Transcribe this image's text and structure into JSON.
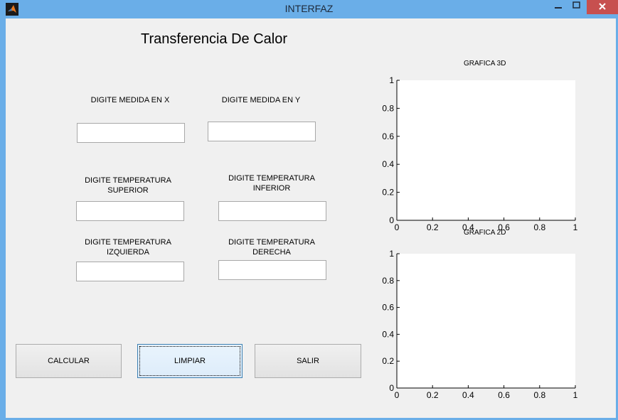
{
  "window": {
    "title": "INTERFAZ"
  },
  "heading": "Transferencia De Calor",
  "fields": {
    "x_label": "DIGITE MEDIDA EN X",
    "y_label": "DIGITE MEDIDA EN Y",
    "sup_label_1": "DIGITE TEMPERATURA",
    "sup_label_2": "SUPERIOR",
    "inf_label_1": "DIGITE TEMPERATURA",
    "inf_label_2": "INFERIOR",
    "izq_label_1": "DIGITE TEMPERATURA",
    "izq_label_2": "IZQUIERDA",
    "der_label_1": "DIGITE TEMPERATURA",
    "der_label_2": "DERECHA",
    "x_value": "",
    "y_value": "",
    "sup_value": "",
    "inf_value": "",
    "izq_value": "",
    "der_value": ""
  },
  "buttons": {
    "calcular": "CALCULAR",
    "limpiar": "LIMPIAR",
    "salir": "SALIR"
  },
  "icons": {
    "app": "matlab-icon",
    "minimize": "minimize-icon",
    "maximize": "maximize-icon",
    "close": "close-icon"
  },
  "colors": {
    "titlebar": "#6aaee8",
    "close": "#c7504f",
    "panel": "#f0f0f0"
  },
  "chart_data": [
    {
      "type": "line",
      "title": "GRAFICA 3D",
      "series": [],
      "xlim": [
        0,
        1
      ],
      "ylim": [
        0,
        1
      ],
      "xticks": [
        "0",
        "0.2",
        "0.4",
        "0.6",
        "0.8",
        "1"
      ],
      "yticks": [
        "0",
        "0.2",
        "0.4",
        "0.6",
        "0.8",
        "1"
      ],
      "grid": false
    },
    {
      "type": "line",
      "title": "GRAFICA 2D",
      "series": [],
      "xlim": [
        0,
        1
      ],
      "ylim": [
        0,
        1
      ],
      "xticks": [
        "0",
        "0.2",
        "0.4",
        "0.6",
        "0.8",
        "1"
      ],
      "yticks": [
        "0",
        "0.2",
        "0.4",
        "0.6",
        "0.8",
        "1"
      ],
      "grid": false
    }
  ]
}
